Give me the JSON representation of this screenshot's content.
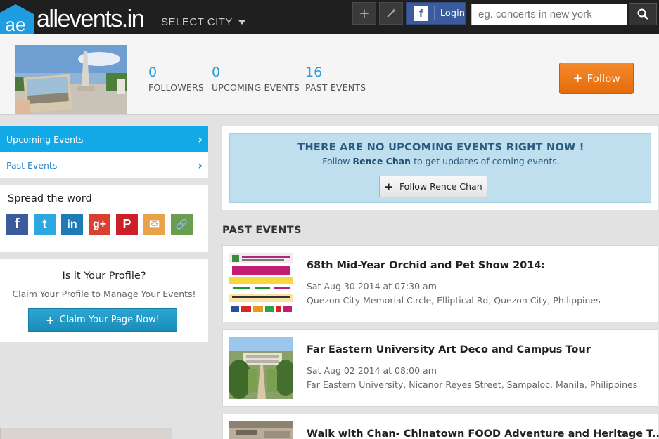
{
  "header": {
    "logo_text": "allevents.in",
    "logo_mark": "ae",
    "select_city": "SELECT CITY",
    "login_fb": "f",
    "login_label": "Login",
    "search_placeholder": "eg. concerts in new york"
  },
  "profile": {
    "stats": [
      {
        "value": "0",
        "label": "FOLLOWERS"
      },
      {
        "value": "0",
        "label": "UPCOMING EVENTS"
      },
      {
        "value": "16",
        "label": "PAST EVENTS"
      }
    ],
    "follow_label": "Follow"
  },
  "sidebar": {
    "nav": [
      {
        "label": "Upcoming Events"
      },
      {
        "label": "Past Events"
      }
    ],
    "spread_title": "Spread the word",
    "share_icons": [
      {
        "name": "facebook-icon",
        "glyph": "f",
        "color": "#3b5b9d"
      },
      {
        "name": "twitter-icon",
        "glyph": "t",
        "color": "#2da7e0"
      },
      {
        "name": "linkedin-icon",
        "glyph": "in",
        "color": "#1f7bb6"
      },
      {
        "name": "google-plus-icon",
        "glyph": "g+",
        "color": "#d8412f"
      },
      {
        "name": "pinterest-icon",
        "glyph": "P",
        "color": "#cb2027"
      },
      {
        "name": "email-icon",
        "glyph": "✉",
        "color": "#e7a24a"
      },
      {
        "name": "link-icon",
        "glyph": "🔗",
        "color": "#6a9d4e"
      }
    ],
    "claim": {
      "title": "Is it Your Profile?",
      "subtitle": "Claim Your Profile to Manage Your Events!",
      "button": "Claim Your Page Now!"
    }
  },
  "main": {
    "no_events": {
      "title": "THERE ARE NO UPCOMING EVENTS RIGHT NOW !",
      "sub_prefix": "Follow",
      "sub_name": "Rence Chan",
      "sub_suffix": "to get updates of coming events.",
      "button": "Follow Rence Chan"
    },
    "past_heading": "PAST EVENTS",
    "events": [
      {
        "title": "68th Mid-Year Orchid and Pet Show 2014:",
        "date": "Sat Aug 30 2014 at 07:30 am",
        "location": "Quezon City Memorial Circle, Elliptical Rd, Quezon City, Philippines"
      },
      {
        "title": "Far Eastern University Art Deco and Campus Tour",
        "date": "Sat Aug 02 2014 at 08:00 am",
        "location": "Far Eastern University, Nicanor Reyes Street, Sampaloc, Manila, Philippines"
      },
      {
        "title": "Walk with Chan- Chinatown FOOD Adventure and Heritage T...",
        "date": "",
        "location": ""
      }
    ]
  },
  "colors": {
    "accent_blue": "#13a8e6",
    "follow_orange": "#f07c1c",
    "stat_blue": "#2a9fd6"
  }
}
